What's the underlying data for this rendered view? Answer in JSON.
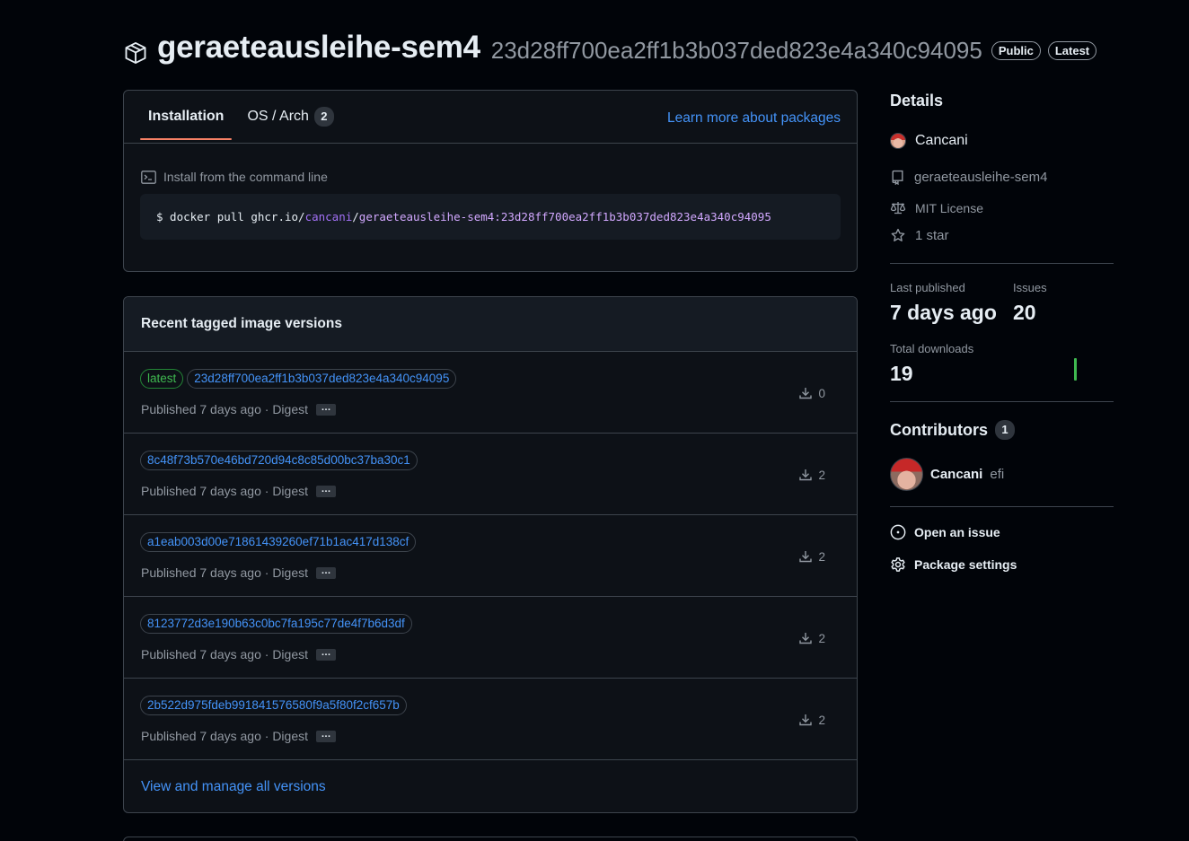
{
  "header": {
    "package_name": "geraeteausleihe-sem4",
    "digest": "23d28ff700ea2ff1b3b037ded823e4a340c94095",
    "badges": [
      "Public",
      "Latest"
    ]
  },
  "install": {
    "tabs": [
      {
        "label": "Installation",
        "count": null
      },
      {
        "label": "OS / Arch",
        "count": "2"
      }
    ],
    "learn_more": "Learn more about packages",
    "label": "Install from the command line",
    "command": {
      "prefix": "$ docker pull ghcr.io/",
      "user": "cancani",
      "slash": "/",
      "image": "geraeteausleihe-sem4:23d28ff700ea2ff1b3b037ded823e4a340c94095"
    }
  },
  "versions": {
    "title": "Recent tagged image versions",
    "items": [
      {
        "tags": [
          "latest",
          "23d28ff700ea2ff1b3b037ded823e4a340c94095"
        ],
        "meta": "Published 7 days ago · Digest",
        "downloads": "0"
      },
      {
        "tags": [
          "8c48f73b570e46bd720d94c8c85d00bc37ba30c1"
        ],
        "meta": "Published 7 days ago · Digest",
        "downloads": "2"
      },
      {
        "tags": [
          "a1eab003d00e71861439260ef71b1ac417d138cf"
        ],
        "meta": "Published 7 days ago · Digest",
        "downloads": "2"
      },
      {
        "tags": [
          "8123772d3e190b63c0bc7fa195c77de4f7b6d3df"
        ],
        "meta": "Published 7 days ago · Digest",
        "downloads": "2"
      },
      {
        "tags": [
          "2b522d975fdeb991841576580f9a5f80f2cf657b"
        ],
        "meta": "Published 7 days ago · Digest",
        "downloads": "2"
      }
    ],
    "more_label": "…",
    "view_all": "View and manage all versions"
  },
  "sidebar": {
    "details_title": "Details",
    "owner": "Cancani",
    "repo": "geraeteausleihe-sem4",
    "license": "MIT License",
    "stars": "1 star",
    "last_published_label": "Last published",
    "last_published_value": "7 days ago",
    "issues_label": "Issues",
    "issues_value": "20",
    "downloads_label": "Total downloads",
    "downloads_value": "19",
    "contributors_title": "Contributors",
    "contributors_count": "1",
    "contributor_name": "Cancani",
    "contributor_login": "efi",
    "open_issue": "Open an issue",
    "package_settings": "Package settings"
  },
  "colors": {
    "background": "#010409",
    "panel": "#0d1117",
    "border": "#3d444d",
    "link": "#4493f8",
    "accent_green": "#3fb950",
    "tab_underline": "#f78166"
  }
}
